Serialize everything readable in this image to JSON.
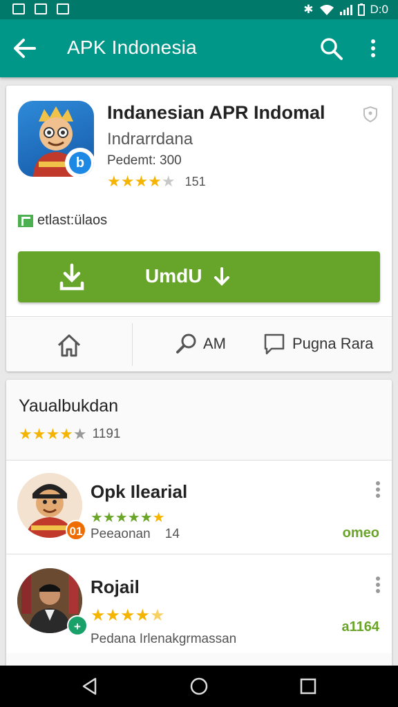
{
  "status_bar": {
    "time": "D:0"
  },
  "app_bar": {
    "title": "APK Indonesia",
    "back_icon": "arrow-back-icon",
    "search_icon": "search-icon",
    "more_icon": "more-vert-icon"
  },
  "app": {
    "title": "Indanesian APR Indomal",
    "developer": "Indrarrdana",
    "meta": "Pedemt: 300",
    "rating": 4.5,
    "rating_count": "151",
    "editor_badge": "etlast:ülaos",
    "install_label": "UmdU",
    "accent_color": "#66a52a"
  },
  "actions": {
    "am_label": "AM",
    "forum_label": "Pugna Rara"
  },
  "reviews": {
    "title": "Yaualbukdan",
    "rating": 4,
    "rating_count": "1191",
    "items": [
      {
        "name": "Opk Ilearial",
        "stars": 5,
        "text": "Peeaonan",
        "count": "14",
        "value": "omeo",
        "badge": "01"
      },
      {
        "name": "Rojail",
        "stars": 4.5,
        "text": "Pedana Irlenakgrmassan",
        "value": "a1164",
        "badge": "+"
      }
    ]
  }
}
